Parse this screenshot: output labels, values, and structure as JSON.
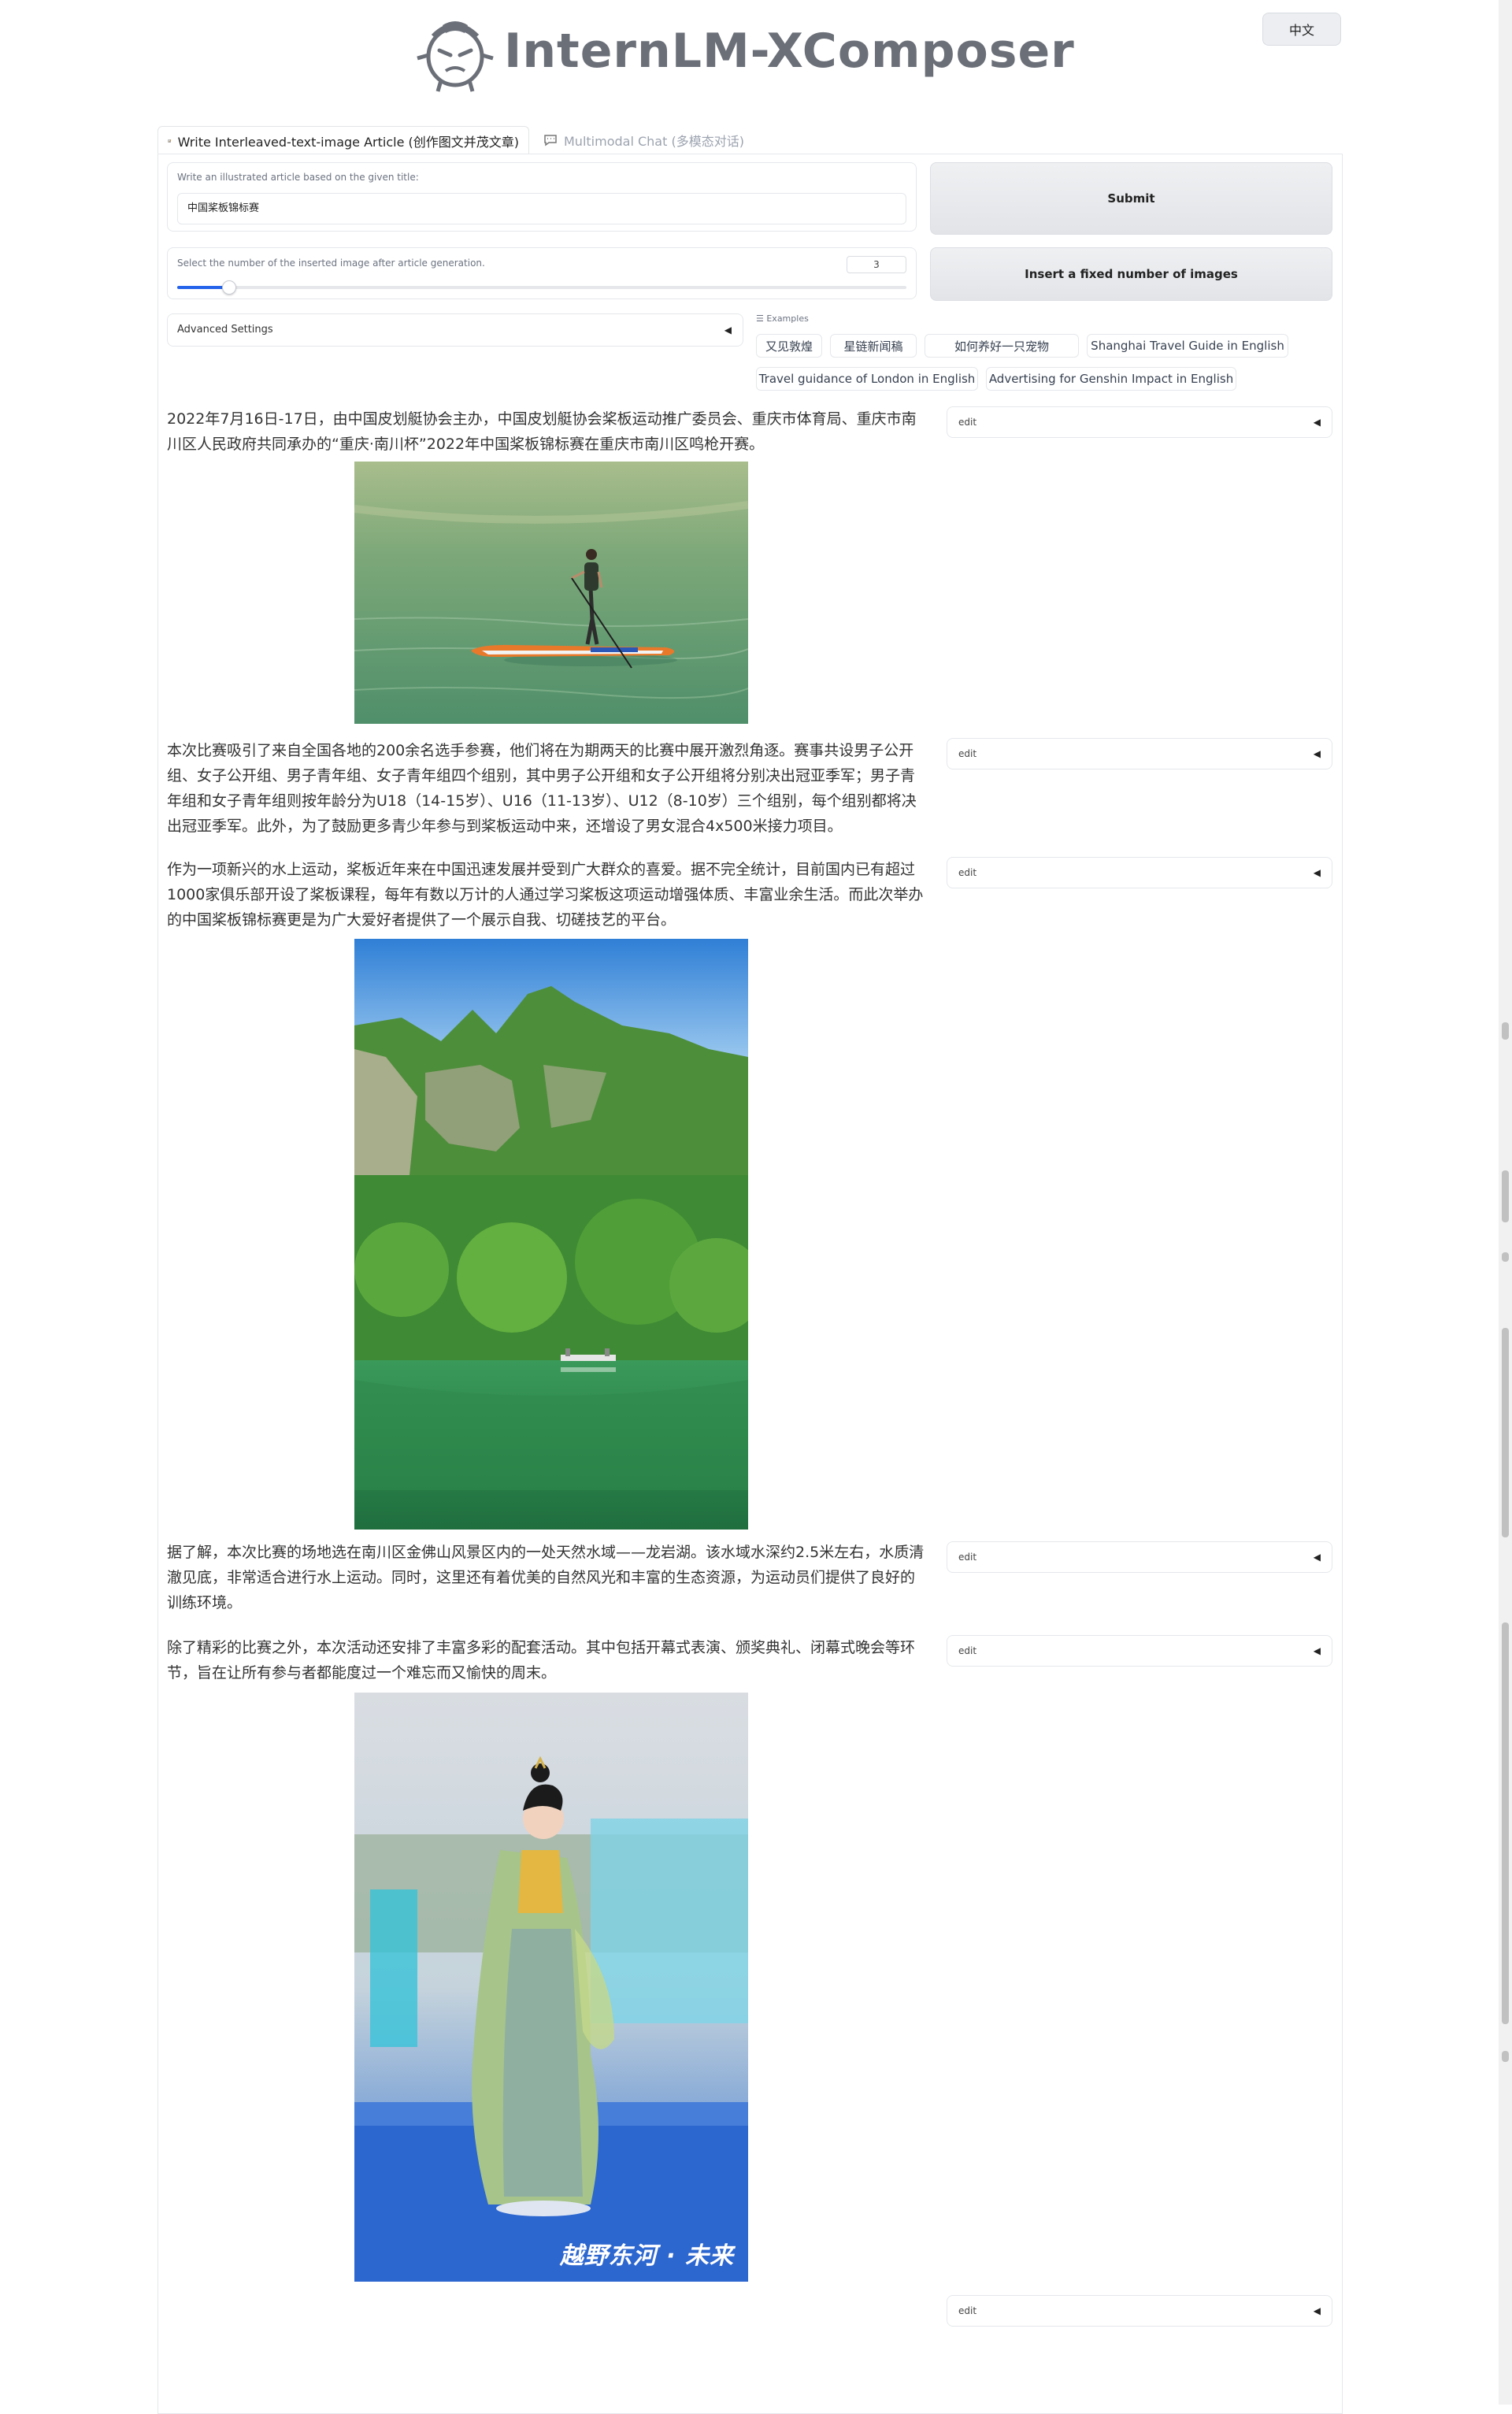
{
  "header": {
    "title": "InternLM-XComposer",
    "language_button": "中文"
  },
  "tabs": [
    {
      "label": "Write Interleaved-text-image Article (创作图文并茂文章)",
      "icon": "notepad-icon",
      "active": true
    },
    {
      "label": "Multimodal Chat (多模态对话)",
      "icon": "chat-bubble-icon",
      "active": false
    }
  ],
  "form": {
    "title_label": "Write an illustrated article based on the given title:",
    "title_value": "中国桨板锦标赛",
    "image_count_label": "Select the number of the inserted image after article generation.",
    "image_count_value": "3",
    "slider_fraction": 0.07,
    "advanced_settings_label": "Advanced Settings",
    "submit_label": "Submit",
    "insert_images_label": "Insert a fixed number of images"
  },
  "examples": {
    "label": "Examples",
    "items": [
      "又见敦煌",
      "星链新闻稿",
      "如何养好一只宠物",
      "Shanghai Travel Guide in English",
      "Travel guidance of London in English",
      "Advertising for Genshin Impact in English"
    ]
  },
  "article": {
    "edit_label": "edit",
    "paragraphs": [
      "2022年7月16日-17日，由中国皮划艇协会主办，中国皮划艇协会桨板运动推广委员会、重庆市体育局、重庆市南川区人民政府共同承办的“重庆·南川杯”2022年中国桨板锦标赛在重庆市南川区鸣枪开赛。",
      "本次比赛吸引了来自全国各地的200余名选手参赛，他们将在为期两天的比赛中展开激烈角逐。赛事共设男子公开组、女子公开组、男子青年组、女子青年组四个组别，其中男子公开组和女子公开组将分别决出冠亚季军；男子青年组和女子青年组则按年龄分为U18（14-15岁）、U16（11-13岁）、U12（8-10岁）三个组别，每个组别都将决出冠亚季军。此外，为了鼓励更多青少年参与到桨板运动中来，还增设了男女混合4x500米接力项目。",
      "作为一项新兴的水上运动，桨板近年来在中国迅速发展并受到广大群众的喜爱。据不完全统计，目前国内已有超过1000家俱乐部开设了桨板课程，每年有数以万计的人通过学习桨板这项运动增强体质、丰富业余生活。而此次举办的中国桨板锦标赛更是为广大爱好者提供了一个展示自我、切磋技艺的平台。",
      "据了解，本次比赛的场地选在南川区金佛山风景区内的一处天然水域——龙岩湖。该水域水深约2.5米左右，水质清澈见底，非常适合进行水上运动。同时，这里还有着优美的自然风光和丰富的生态资源，为运动员们提供了良好的训练环境。",
      "除了精彩的比赛之外，本次活动还安排了丰富多彩的配套活动。其中包括开幕式表演、颁奖典礼、闭幕式晚会等环节，旨在让所有参与者都能度过一个难忘而又愉快的周末。"
    ],
    "images": [
      {
        "name": "paddleboard-photo"
      },
      {
        "name": "lake-mountain-photo"
      },
      {
        "name": "hanfu-woman-photo",
        "watermark": "越野东河 · 未来"
      }
    ]
  }
}
